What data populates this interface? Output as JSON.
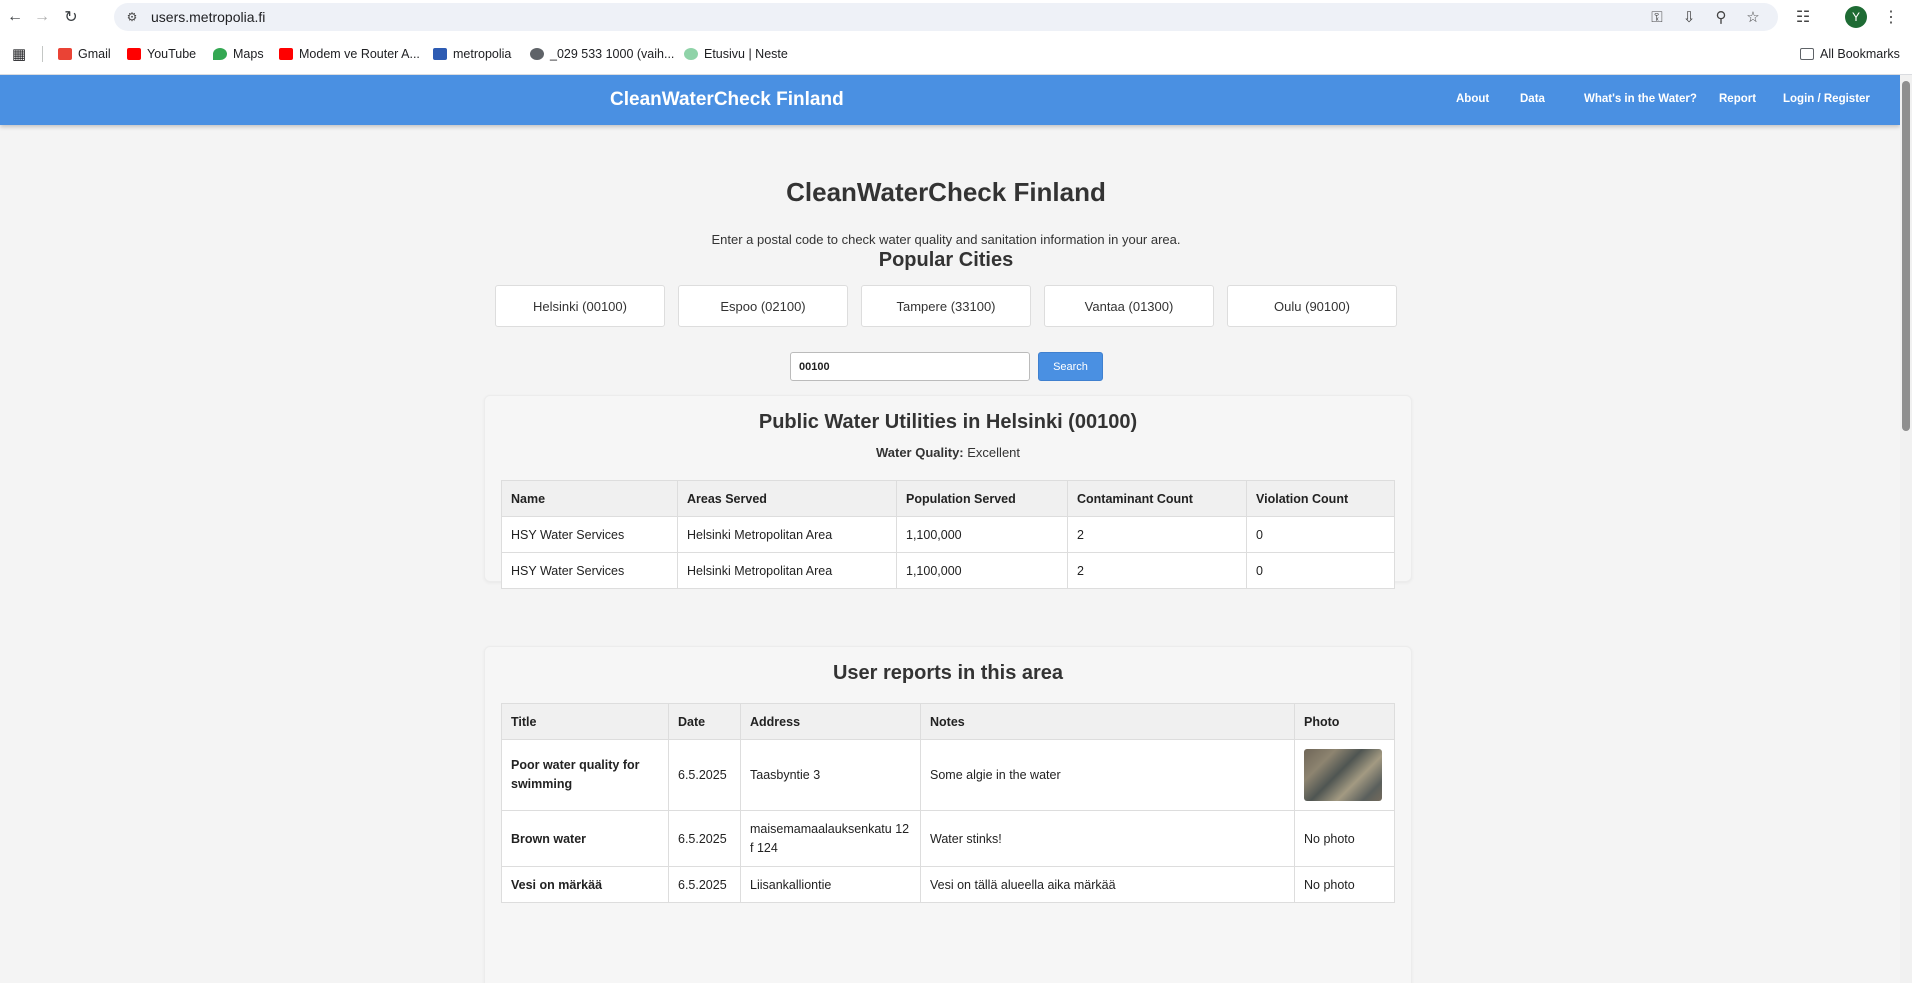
{
  "browser": {
    "url": "users.metropolia.fi",
    "avatar_letter": "Y",
    "bookmarks": [
      {
        "label": "Gmail",
        "color": "#ea4335"
      },
      {
        "label": "YouTube",
        "color": "#ff0000"
      },
      {
        "label": "Maps",
        "color": "#34a853"
      },
      {
        "label": "Modem ve Router A...",
        "color": "#ff0000"
      },
      {
        "label": "metropolia",
        "color": "#2d5bb3"
      },
      {
        "label": "_029 533 1000 (vaih...",
        "color": "#5f6368"
      },
      {
        "label": "Etusivu | Neste",
        "color": "#8fd3a8"
      }
    ],
    "all_bookmarks": "All Bookmarks"
  },
  "header": {
    "brand": "CleanWaterCheck Finland",
    "nav": [
      "About",
      "Data",
      "What's in the Water?",
      "Report",
      "Login / Register"
    ]
  },
  "hero": {
    "title": "CleanWaterCheck Finland",
    "subtitle": "Enter a postal code to check water quality and sanitation information in your area."
  },
  "popular": {
    "title": "Popular Cities",
    "cities": [
      "Helsinki (00100)",
      "Espoo (02100)",
      "Tampere (33100)",
      "Vantaa (01300)",
      "Oulu (90100)"
    ]
  },
  "search": {
    "value": "00100",
    "button": "Search"
  },
  "utilities": {
    "title": "Public Water Utilities in Helsinki (00100)",
    "quality_label": "Water Quality:",
    "quality_value": "Excellent",
    "columns": [
      "Name",
      "Areas Served",
      "Population Served",
      "Contaminant Count",
      "Violation Count"
    ],
    "rows": [
      [
        "HSY Water Services",
        "Helsinki Metropolitan Area",
        "1,100,000",
        "2",
        "0"
      ],
      [
        "HSY Water Services",
        "Helsinki Metropolitan Area",
        "1,100,000",
        "2",
        "0"
      ]
    ]
  },
  "reports": {
    "title": "User reports in this area",
    "columns": [
      "Title",
      "Date",
      "Address",
      "Notes",
      "Photo"
    ],
    "rows": [
      {
        "title": "Poor water quality for swimming",
        "date": "6.5.2025",
        "address": "Taasbyntie 3",
        "notes": "Some algie in the water",
        "photo": ""
      },
      {
        "title": "Brown water",
        "date": "6.5.2025",
        "address": "maisemamaalauksenkatu 12 f 124",
        "notes": "Water stinks!",
        "photo": "No photo"
      },
      {
        "title": "Vesi on märkää",
        "date": "6.5.2025",
        "address": "Liisankalliontie",
        "notes": "Vesi on tällä alueella aika märkää",
        "photo": "No photo"
      }
    ]
  }
}
